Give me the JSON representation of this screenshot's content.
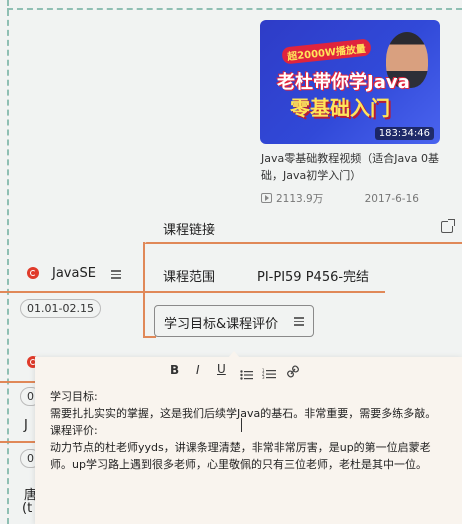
{
  "video": {
    "badge": "超2000W播放量",
    "thumb_line1": "老杜带你学Java",
    "thumb_line2": "零基础入门",
    "duration": "183:34:46",
    "title": "Java零基础教程视频（适合Java 0基础，Java初学入门）",
    "views": "2113.9万",
    "date": "2017-6-16"
  },
  "fields": {
    "course_link_label": "课程链接",
    "course_range_label": "课程范围",
    "course_range_value": "PI-PI59  P456-完结",
    "goal_label": "学习目标&课程评价"
  },
  "node": {
    "label": "JavaSE",
    "date_range": "01.01-02.15"
  },
  "left_partial": {
    "a": "0",
    "b": "J",
    "c": "0",
    "d": "唐",
    "e": "(t"
  },
  "toolbar": {
    "bold": "B",
    "italic": "I",
    "underline": "U"
  },
  "content": {
    "goal_heading": "学习目标:",
    "goal_text": "需要扎扎实实的掌握，这是我们后续学Java的基石。非常重要，需要多练多敲。",
    "eval_heading": "课程评价:",
    "eval_text": "动力节点的杜老师yyds，讲课条理清楚，非常非常厉害，是up的第一位启蒙老师。up学习路上遇到很多老师，心里敬佩的只有三位老师，老杜是其中一位。"
  },
  "icons": {
    "external_link": "external-link-icon",
    "menu": "menu-icon",
    "node_marker": "record-icon"
  },
  "colors": {
    "connector": "#e08858",
    "marker": "#e03b2b",
    "dash": "#8fbfb3"
  }
}
